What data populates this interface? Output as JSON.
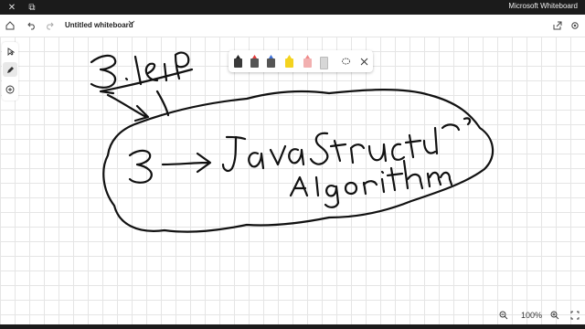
{
  "window": {
    "app_title": "Microsoft Whiteboard",
    "controls": {
      "close_glyph": "✕",
      "restore_glyph": "⧉"
    }
  },
  "topbar": {
    "doc_title": "Untitled whiteboard",
    "icons": [
      "home-icon",
      "undo-icon",
      "redo-icon",
      "chevron-down-icon",
      "share-icon",
      "settings-icon"
    ]
  },
  "leftbar": {
    "tools": [
      "select-tool",
      "ink-tool",
      "add-tool"
    ]
  },
  "ink_toolbar": {
    "pens": [
      {
        "name": "black-pen",
        "color": "#222222"
      },
      {
        "name": "red-pen",
        "color": "#e23a3a"
      },
      {
        "name": "blue-pen",
        "color": "#3b6fd8"
      },
      {
        "name": "yellow-highlighter",
        "color": "#f4d31f"
      },
      {
        "name": "pink-highlighter",
        "color": "#f08a8a"
      },
      {
        "name": "eraser",
        "color": "#d7d7d7"
      }
    ]
  },
  "zoom": {
    "level": "100%"
  }
}
